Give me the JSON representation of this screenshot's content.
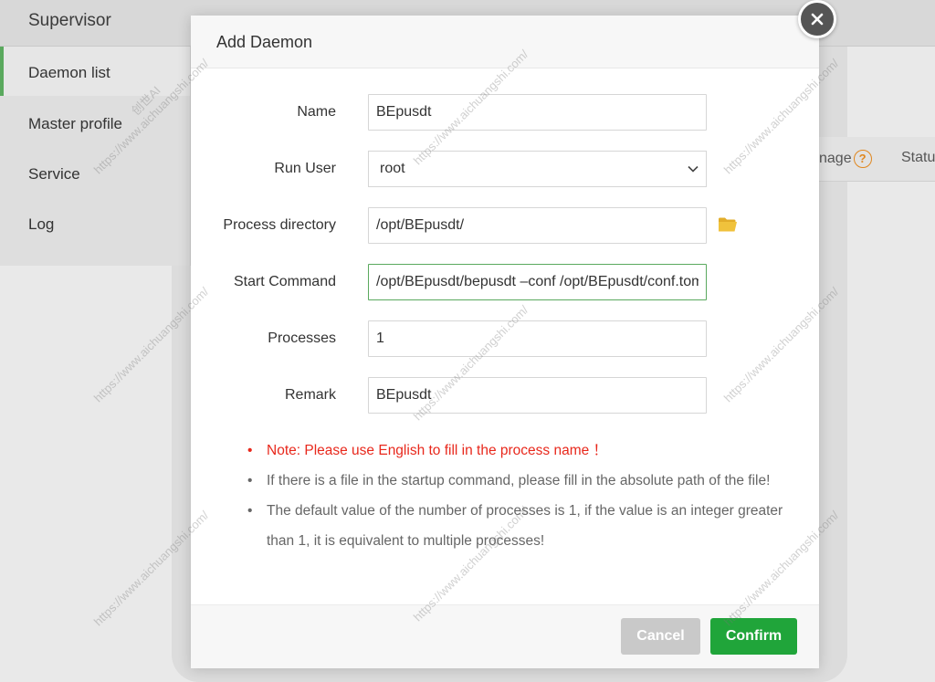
{
  "background": {
    "app_title": "Supervisor",
    "sidebar": [
      {
        "label": "Daemon list"
      },
      {
        "label": "Master profile"
      },
      {
        "label": "Service"
      },
      {
        "label": "Log"
      }
    ],
    "columns": {
      "manage_partial": "nage",
      "help_glyph": "?",
      "status_partial": "Statu"
    }
  },
  "modal": {
    "title": "Add Daemon",
    "fields": {
      "name": {
        "label": "Name",
        "value": "BEpusdt"
      },
      "run_user": {
        "label": "Run User",
        "value": "root"
      },
      "process_directory": {
        "label": "Process directory",
        "value": "/opt/BEpusdt/"
      },
      "start_command": {
        "label": "Start Command",
        "value": "/opt/BEpusdt/bepusdt –conf /opt/BEpusdt/conf.toml"
      },
      "processes": {
        "label": "Processes",
        "value": "1"
      },
      "remark": {
        "label": "Remark",
        "value": "BEpusdt"
      }
    },
    "notes": [
      {
        "text": "Note: Please use English to fill in the process name ！"
      },
      {
        "text": "If there is a file in the startup command, please fill in the absolute path of the file!"
      },
      {
        "text": "The default value of the number of processes is 1, if the value is an integer greater than 1, it is equivalent to multiple processes!"
      }
    ],
    "buttons": {
      "cancel": "Cancel",
      "confirm": "Confirm"
    }
  },
  "watermark": {
    "brand": "创世AI",
    "url": "https://www.aichuangshi.com/"
  },
  "colors": {
    "accent": "#20a53a",
    "note_red": "#e8281c",
    "folder": "#f0c23c"
  }
}
